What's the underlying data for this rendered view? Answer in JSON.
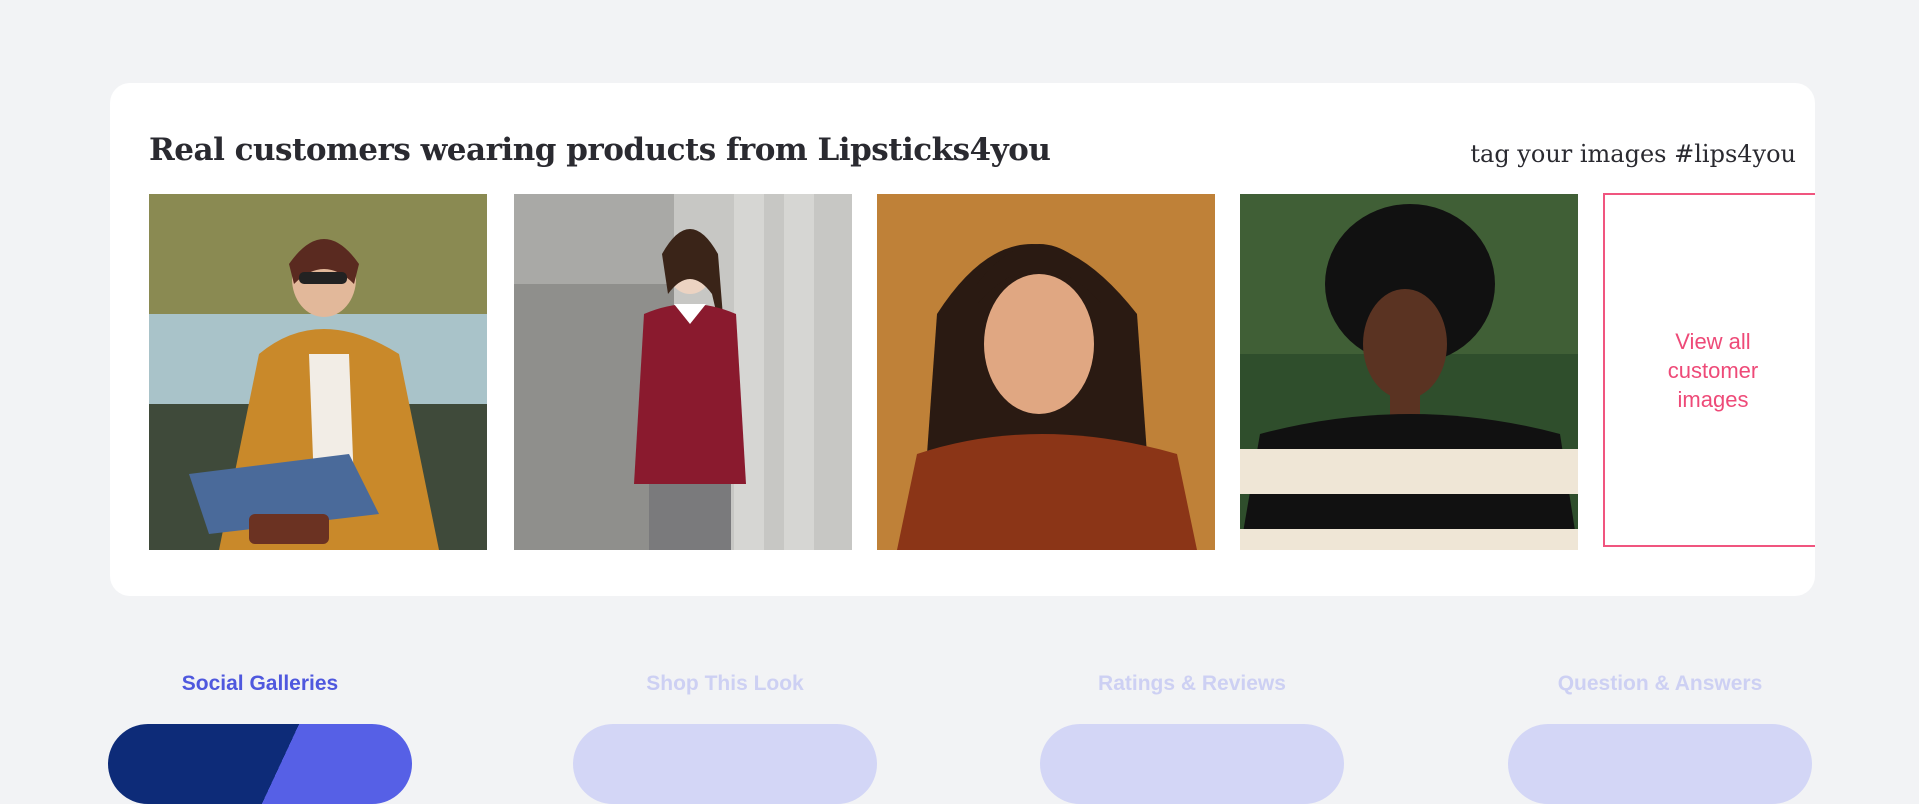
{
  "gallery": {
    "title": "Real customers wearing products from Lipsticks4you",
    "tag_text": "tag your images #lips4you",
    "view_all_label": "View all customer images",
    "photos": [
      {
        "icon": "photo-woman-mustard-blazer"
      },
      {
        "icon": "photo-woman-burgundy-sweater"
      },
      {
        "icon": "photo-woman-rust-cardigan"
      },
      {
        "icon": "photo-woman-striped-sweater"
      }
    ],
    "accent_color": "#ee4a78"
  },
  "tabs": [
    {
      "label": "Social Galleries",
      "active": true
    },
    {
      "label": "Shop This Look",
      "active": false
    },
    {
      "label": "Ratings & Reviews",
      "active": false
    },
    {
      "label": "Question & Answers",
      "active": false
    }
  ],
  "colors": {
    "background": "#f2f3f5",
    "active_tab": "#4f58de",
    "inactive_tab": "#cdd0f3",
    "active_pill_dark": "#0d2b78"
  }
}
